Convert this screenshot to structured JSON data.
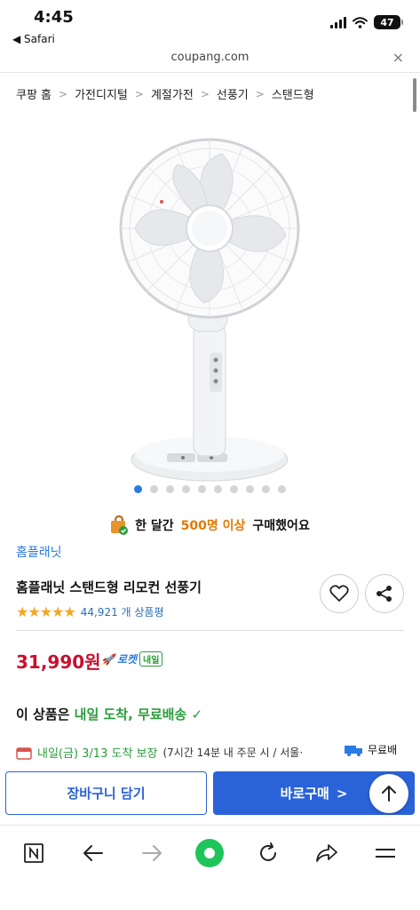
{
  "status": {
    "time": "4:45",
    "back": "◀ Safari",
    "battery": "47"
  },
  "url": {
    "domain": "coupang.com",
    "close": "×"
  },
  "breadcrumb": [
    "쿠팡 홈",
    "가전디지털",
    "계절가전",
    "선풍기",
    "스탠드형"
  ],
  "gallery": {
    "count": 10,
    "active": 0
  },
  "purchased": {
    "prefix": "한 달간",
    "highlight": "500명 이상",
    "suffix": "구매했어요"
  },
  "product": {
    "brand": "홈플래닛",
    "title": "홈플래닛 스탠드형 리모컨 선풍기",
    "rating": 4.5,
    "review_count": "44,921 개 상품평"
  },
  "price": {
    "amount": "31,990원",
    "rocket_label": "로켓",
    "rocket_tag": "내일"
  },
  "delivery": {
    "prefix": "이 상품은",
    "highlight": "내일 도착, 무료배송",
    "arrival_date": "내일(금) 3/13 도착 보장",
    "arrival_note": "(7시간 14분 내 주문 시 / 서울·",
    "free_label": "무료배"
  },
  "actions": {
    "cart": "장바구니 담기",
    "buy": "바로구매"
  },
  "colors": {
    "accent": "#2a62d8",
    "price": "#c8102e",
    "green": "#2a9d3a",
    "highlight": "#e07b00"
  }
}
